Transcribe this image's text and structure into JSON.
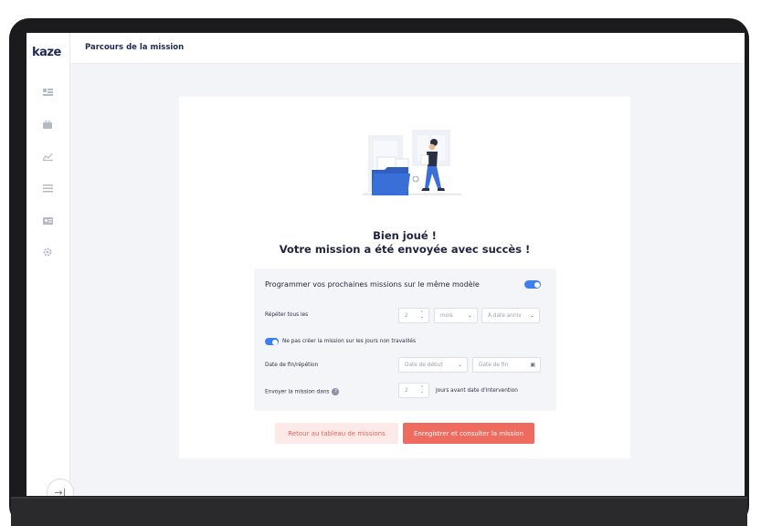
{
  "app": {
    "logo_text": "kaze",
    "page_title": "Parcours de la mission"
  },
  "sidebar": {
    "items": [
      {
        "icon": "dashboard-icon"
      },
      {
        "icon": "briefcase-icon"
      },
      {
        "icon": "chart-icon"
      },
      {
        "icon": "list-icon"
      },
      {
        "icon": "id-card-icon"
      },
      {
        "icon": "gear-icon"
      }
    ],
    "collapse_icon": "collapse-arrow-icon"
  },
  "success": {
    "line1": "Bien joué !",
    "line2": "Votre mission a été envoyée avec succès !"
  },
  "schedule": {
    "title": "Programmer vos prochaines missions sur le même modèle",
    "enabled": true,
    "repeat_label": "Répéter tous les",
    "repeat_value": "2",
    "repeat_unit": "mois",
    "repeat_anchor": "À date anniv",
    "skip_nonworking_label": "Ne pas créer la mission sur les jours non travaillés",
    "skip_nonworking_enabled": true,
    "end_label": "Date de fin/répétion",
    "end_mode_placeholder": "Date de début",
    "end_date_placeholder": "Date de fin",
    "send_label": "Envoyer la mission dans",
    "send_value": "2",
    "send_suffix": "Jours avant date d'intervention"
  },
  "actions": {
    "back_label": "Retour au tableau de missions",
    "save_label": "Enregistrer et consulter la mission"
  },
  "colors": {
    "accent": "#3d7ff0",
    "brand": "#ef6b5f",
    "brand_light": "#fde9e7"
  }
}
